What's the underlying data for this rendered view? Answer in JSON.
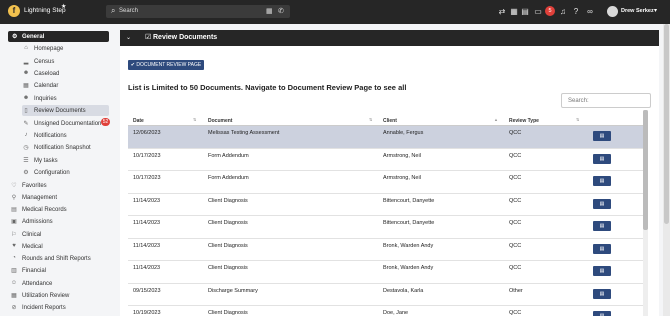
{
  "app": {
    "name": "Lightning Step",
    "logo_letter": "f",
    "star": "★"
  },
  "search": {
    "placeholder": "Search",
    "icon": "search-icon"
  },
  "toolbar_icons": [
    "transfer-icon",
    "calendar-icon",
    "grid-icon",
    "chat-icon",
    "notifications-icon",
    "help-icon",
    "link-icon"
  ],
  "notifications": {
    "count": "5"
  },
  "user": {
    "name": "Drew Serkez"
  },
  "sidebar": {
    "general_label": "General",
    "general_items": [
      {
        "label": "Homepage",
        "icon": "home-icon"
      },
      {
        "label": "Census",
        "icon": "chart-icon"
      },
      {
        "label": "Caseload",
        "icon": "person-icon"
      },
      {
        "label": "Calendar",
        "icon": "calendar-icon"
      },
      {
        "label": "Inquiries",
        "icon": "person-icon"
      },
      {
        "label": "Review Documents",
        "icon": "document-icon"
      },
      {
        "label": "Unsigned Documentation",
        "icon": "pen-icon"
      },
      {
        "label": "Notifications",
        "icon": "bell-icon"
      },
      {
        "label": "Notification Snapshot",
        "icon": "clock-icon"
      },
      {
        "label": "My tasks",
        "icon": "tasks-icon"
      },
      {
        "label": "Configuration",
        "icon": "gear-icon"
      }
    ],
    "unsigned_count": "52",
    "sections": [
      {
        "label": "Favorites",
        "icon": "heart-icon"
      },
      {
        "label": "Management",
        "icon": "location-icon"
      },
      {
        "label": "Medical Records",
        "icon": "records-icon"
      },
      {
        "label": "Admissions",
        "icon": "admissions-icon"
      },
      {
        "label": "Clinical",
        "icon": "clinical-icon"
      },
      {
        "label": "Medical",
        "icon": "medical-icon"
      },
      {
        "label": "Rounds and Shift Reports",
        "icon": "rounds-icon"
      },
      {
        "label": "Financial",
        "icon": "financial-icon"
      },
      {
        "label": "Attendance",
        "icon": "attendance-icon"
      },
      {
        "label": "Utilization Review",
        "icon": "review-icon"
      },
      {
        "label": "Incident Reports",
        "icon": "incident-icon"
      }
    ]
  },
  "panel": {
    "title": "Review Documents",
    "button_label": "✔ DOCUMENT REVIEW PAGE",
    "notice": "List is Limited to 50 Documents. Navigate to Document Review Page to see all",
    "search_placeholder": "Search:"
  },
  "table": {
    "headers": [
      "Date",
      "Document",
      "Client",
      "Review Type"
    ],
    "rows": [
      {
        "date": "12/06/2023",
        "document": "Melissas Testing Assessment",
        "client": "Annable, Fergus",
        "type": "QCC"
      },
      {
        "date": "10/17/2023",
        "document": "Form Addendum",
        "client": "Armstrong, Neil",
        "type": "QCC"
      },
      {
        "date": "10/17/2023",
        "document": "Form Addendum",
        "client": "Armstrong, Neil",
        "type": "QCC"
      },
      {
        "date": "11/14/2023",
        "document": "Client Diagnosis",
        "client": "Bittencourt, Danyette",
        "type": "QCC"
      },
      {
        "date": "11/14/2023",
        "document": "Client Diagnosis",
        "client": "Bittencourt, Danyette",
        "type": "QCC"
      },
      {
        "date": "11/14/2023",
        "document": "Client Diagnosis",
        "client": "Bronk, Warden Andy",
        "type": "QCC"
      },
      {
        "date": "11/14/2023",
        "document": "Client Diagnosis",
        "client": "Bronk, Warden Andy",
        "type": "QCC"
      },
      {
        "date": "09/15/2023",
        "document": "Discharge Summary",
        "client": "Destavola, Karla",
        "type": "Other"
      },
      {
        "date": "10/19/2023",
        "document": "Client Diagnosis",
        "client": "Doe, Jane",
        "type": "QCC"
      }
    ]
  }
}
